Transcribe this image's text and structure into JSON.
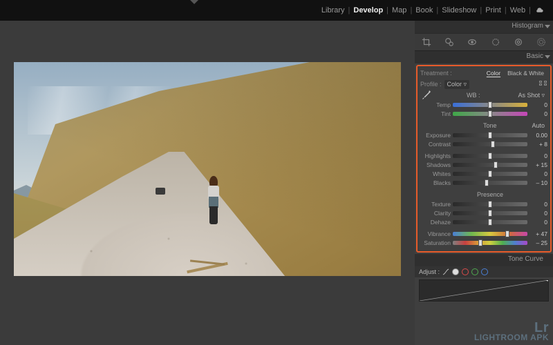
{
  "modules": {
    "items": [
      "Library",
      "Develop",
      "Map",
      "Book",
      "Slideshow",
      "Print",
      "Web"
    ],
    "active": "Develop"
  },
  "panels": {
    "histogram_label": "Histogram",
    "basic_label": "Basic",
    "tonecurve_label": "Tone Curve",
    "adjust_label": "Adjust :"
  },
  "basic": {
    "treatment_label": "Treatment :",
    "treatment_options": {
      "color": "Color",
      "bw": "Black & White"
    },
    "profile_label": "Profile :",
    "profile_value": "Color",
    "wb_label": "WB :",
    "wb_value": "As Shot",
    "tone_label": "Tone",
    "tone_auto": "Auto",
    "presence_label": "Presence",
    "sliders": {
      "temp": {
        "label": "Temp",
        "value": "0",
        "pos": 50,
        "track": "temp"
      },
      "tint": {
        "label": "Tint",
        "value": "0",
        "pos": 50,
        "track": "tint"
      },
      "exposure": {
        "label": "Exposure",
        "value": "0.00",
        "pos": 50,
        "track": "plain"
      },
      "contrast": {
        "label": "Contrast",
        "value": "+ 8",
        "pos": 54,
        "track": "plain"
      },
      "highlights": {
        "label": "Highlights",
        "value": "0",
        "pos": 50,
        "track": "plain"
      },
      "shadows": {
        "label": "Shadows",
        "value": "+ 15",
        "pos": 57,
        "track": "plain"
      },
      "whites": {
        "label": "Whites",
        "value": "0",
        "pos": 50,
        "track": "plain"
      },
      "blacks": {
        "label": "Blacks",
        "value": "– 10",
        "pos": 45,
        "track": "plain"
      },
      "texture": {
        "label": "Texture",
        "value": "0",
        "pos": 50,
        "track": "plain"
      },
      "clarity": {
        "label": "Clarity",
        "value": "0",
        "pos": 50,
        "track": "plain"
      },
      "dehaze": {
        "label": "Dehaze",
        "value": "0",
        "pos": 50,
        "track": "plain"
      },
      "vibrance": {
        "label": "Vibrance",
        "value": "+ 47",
        "pos": 73,
        "track": "vib"
      },
      "saturation": {
        "label": "Saturation",
        "value": "– 25",
        "pos": 37,
        "track": "sat"
      }
    }
  },
  "watermark": {
    "logo": "Lr",
    "text": "LIGHTROOM APK"
  }
}
